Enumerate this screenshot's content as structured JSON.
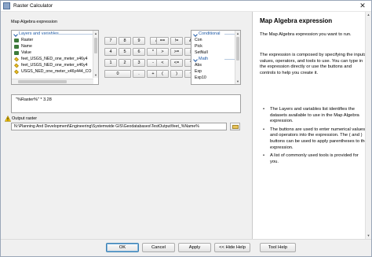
{
  "window": {
    "title": "Raster Calculator",
    "close_glyph": "✕"
  },
  "expression_label": "Map Algebra expression",
  "layers": {
    "header": "Layers and variables",
    "items": [
      {
        "label": "Raster",
        "icon": "raster-icon"
      },
      {
        "label": "Name",
        "icon": "raster-icon"
      },
      {
        "label": "Value",
        "icon": "raster-icon"
      },
      {
        "label": "feet_USGS_NED_one_meter_x46y4",
        "icon": "layer-diamond-icon"
      },
      {
        "label": "feet_USGS_NED_one_meter_x46y4",
        "icon": "layer-diamond-icon"
      },
      {
        "label": "USGS_NED_one_meter_x46y444_CO",
        "icon": "layer-diamond-icon"
      }
    ]
  },
  "calculator": {
    "rows": [
      [
        "7",
        "8",
        "9",
        "/",
        "==",
        "!=",
        "&"
      ],
      [
        "4",
        "5",
        "6",
        "*",
        ">",
        ">=",
        "|"
      ],
      [
        "1",
        "2",
        "3",
        "-",
        "<",
        "<=",
        "^"
      ],
      [
        "0",
        ".",
        "+",
        "(",
        ")",
        "~"
      ]
    ]
  },
  "tools": {
    "conditional_header": "Conditional",
    "conditional_items": [
      "Con",
      "Pick",
      "SetNull"
    ],
    "math_header": "Math",
    "math_items": [
      "Abs",
      "Exp",
      "Exp10"
    ]
  },
  "expression": {
    "value": "\"%Raster%\" * 3.28"
  },
  "output": {
    "label": "Output raster",
    "value": "N:\\Planning And Development\\Engineering\\Systemwide GIS\\Geodatabases\\TestOutput\\feet_%Name%"
  },
  "help": {
    "title": "Map Algebra expression",
    "paragraphs": [
      "The Map Algebra expression you want to run.",
      "The expression is composed by specifying the inputs, values, operators, and tools to use. You can type in the expression directly or use the buttons and controls to help you create it."
    ],
    "bullets": [
      "The Layers and variables list identifies the datasets available to use in the Map Algebra expression.",
      "The buttons are used to enter numerical values and operators into the expression. The ( and ) buttons can be used to apply parentheses to the expression.",
      "A list of commonly used tools is provided for you."
    ]
  },
  "buttons": {
    "ok": "OK",
    "cancel": "Cancel",
    "apply": "Apply",
    "hide_help": "<< Hide Help",
    "tool_help": "Tool Help"
  }
}
